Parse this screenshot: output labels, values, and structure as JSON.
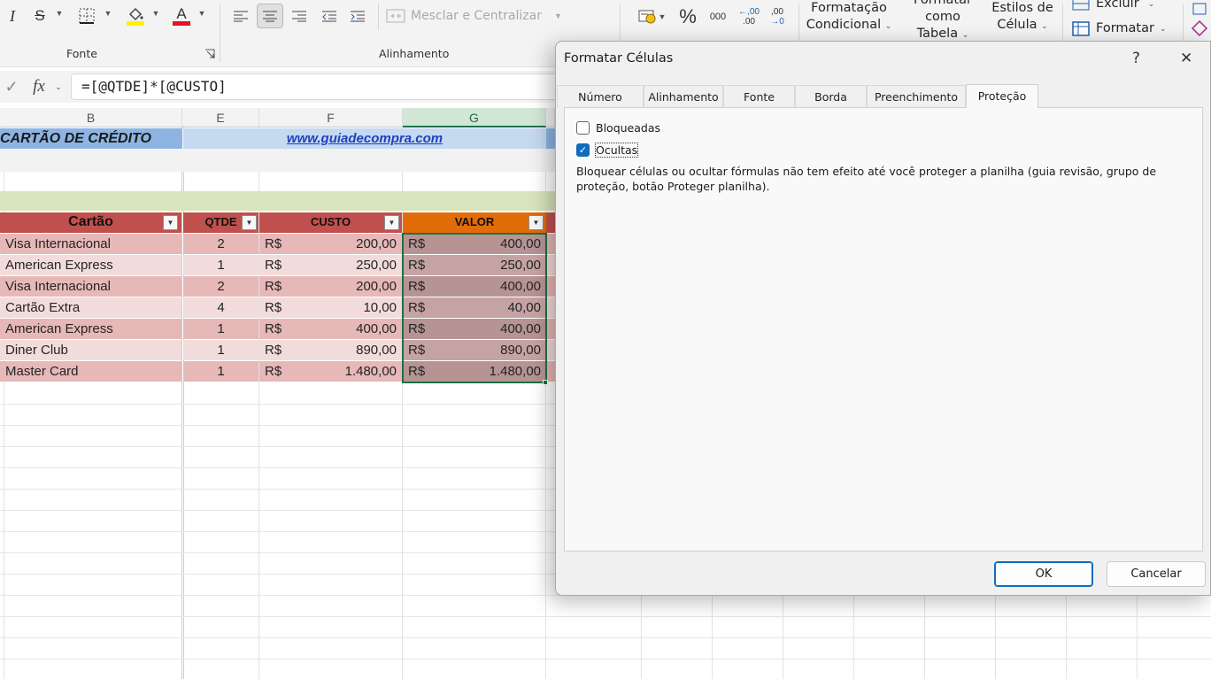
{
  "ribbon": {
    "font_group_label": "Fonte",
    "alignment_group_label": "Alinhamento",
    "merge_label": "Mesclar e Centralizar",
    "cond_format_line1": "Formatação",
    "cond_format_line2": "Condicional",
    "format_table_line1": "Formatar como",
    "format_table_line2": "Tabela",
    "cell_styles_line1": "Estilos de",
    "cell_styles_line2": "Célula",
    "delete_label": "Excluir",
    "format_label": "Formatar",
    "percent_symbol": "%",
    "thousands_symbol": "000",
    "dec_increase": ",00",
    "dec_decrease": ",00",
    "italic": "I",
    "strike": "S",
    "font_color_letter": "A",
    "highlight_color": "#FFF200",
    "font_color": "#E81123"
  },
  "formula_bar": {
    "fx": "fx",
    "formula": "=[@QTDE]*[@CUSTO]"
  },
  "sheet": {
    "columns": [
      "B",
      "E",
      "F",
      "G"
    ],
    "title_left": "CARTÃO  DE  CRÉDITO",
    "title_link": "www.guiadecompra.com",
    "headers": {
      "cartao": "Cartão",
      "qtde": "QTDE",
      "custo": "CUSTO",
      "valor": "VALOR"
    },
    "currency": "R$",
    "rows": [
      {
        "cartao": "Visa Internacional",
        "qtde": "2",
        "custo": "200,00",
        "valor": "400,00"
      },
      {
        "cartao": "American Express",
        "qtde": "1",
        "custo": "250,00",
        "valor": "250,00"
      },
      {
        "cartao": "Visa Internacional",
        "qtde": "2",
        "custo": "200,00",
        "valor": "400,00"
      },
      {
        "cartao": "Cartão Extra",
        "qtde": "4",
        "custo": "10,00",
        "valor": "40,00"
      },
      {
        "cartao": "American Express",
        "qtde": "1",
        "custo": "400,00",
        "valor": "400,00"
      },
      {
        "cartao": "Diner Club",
        "qtde": "1",
        "custo": "890,00",
        "valor": "890,00"
      },
      {
        "cartao": "Master Card",
        "qtde": "1",
        "custo": "1.480,00",
        "valor": "1.480,00"
      }
    ],
    "colors": {
      "header_red": "#C0504D",
      "header_orange": "#E26B0A",
      "row_dark": "#E6B8B7",
      "row_light": "#F2DCDB",
      "band_green": "#D8E4BC",
      "title_blue": "#C5D9F1"
    }
  },
  "dialog": {
    "title": "Formatar Células",
    "help": "?",
    "close": "✕",
    "tabs": [
      "Número",
      "Alinhamento",
      "Fonte",
      "Borda",
      "Preenchimento",
      "Proteção"
    ],
    "active_tab": "Proteção",
    "locked_label": "Bloqueadas",
    "locked_checked": false,
    "hidden_label": "Ocultas",
    "hidden_checked": true,
    "note": "Bloquear células ou ocultar fórmulas não tem efeito até você proteger a planilha (guia revisão, grupo de proteção, botão Proteger planilha).",
    "ok_label": "OK",
    "cancel_label": "Cancelar"
  }
}
